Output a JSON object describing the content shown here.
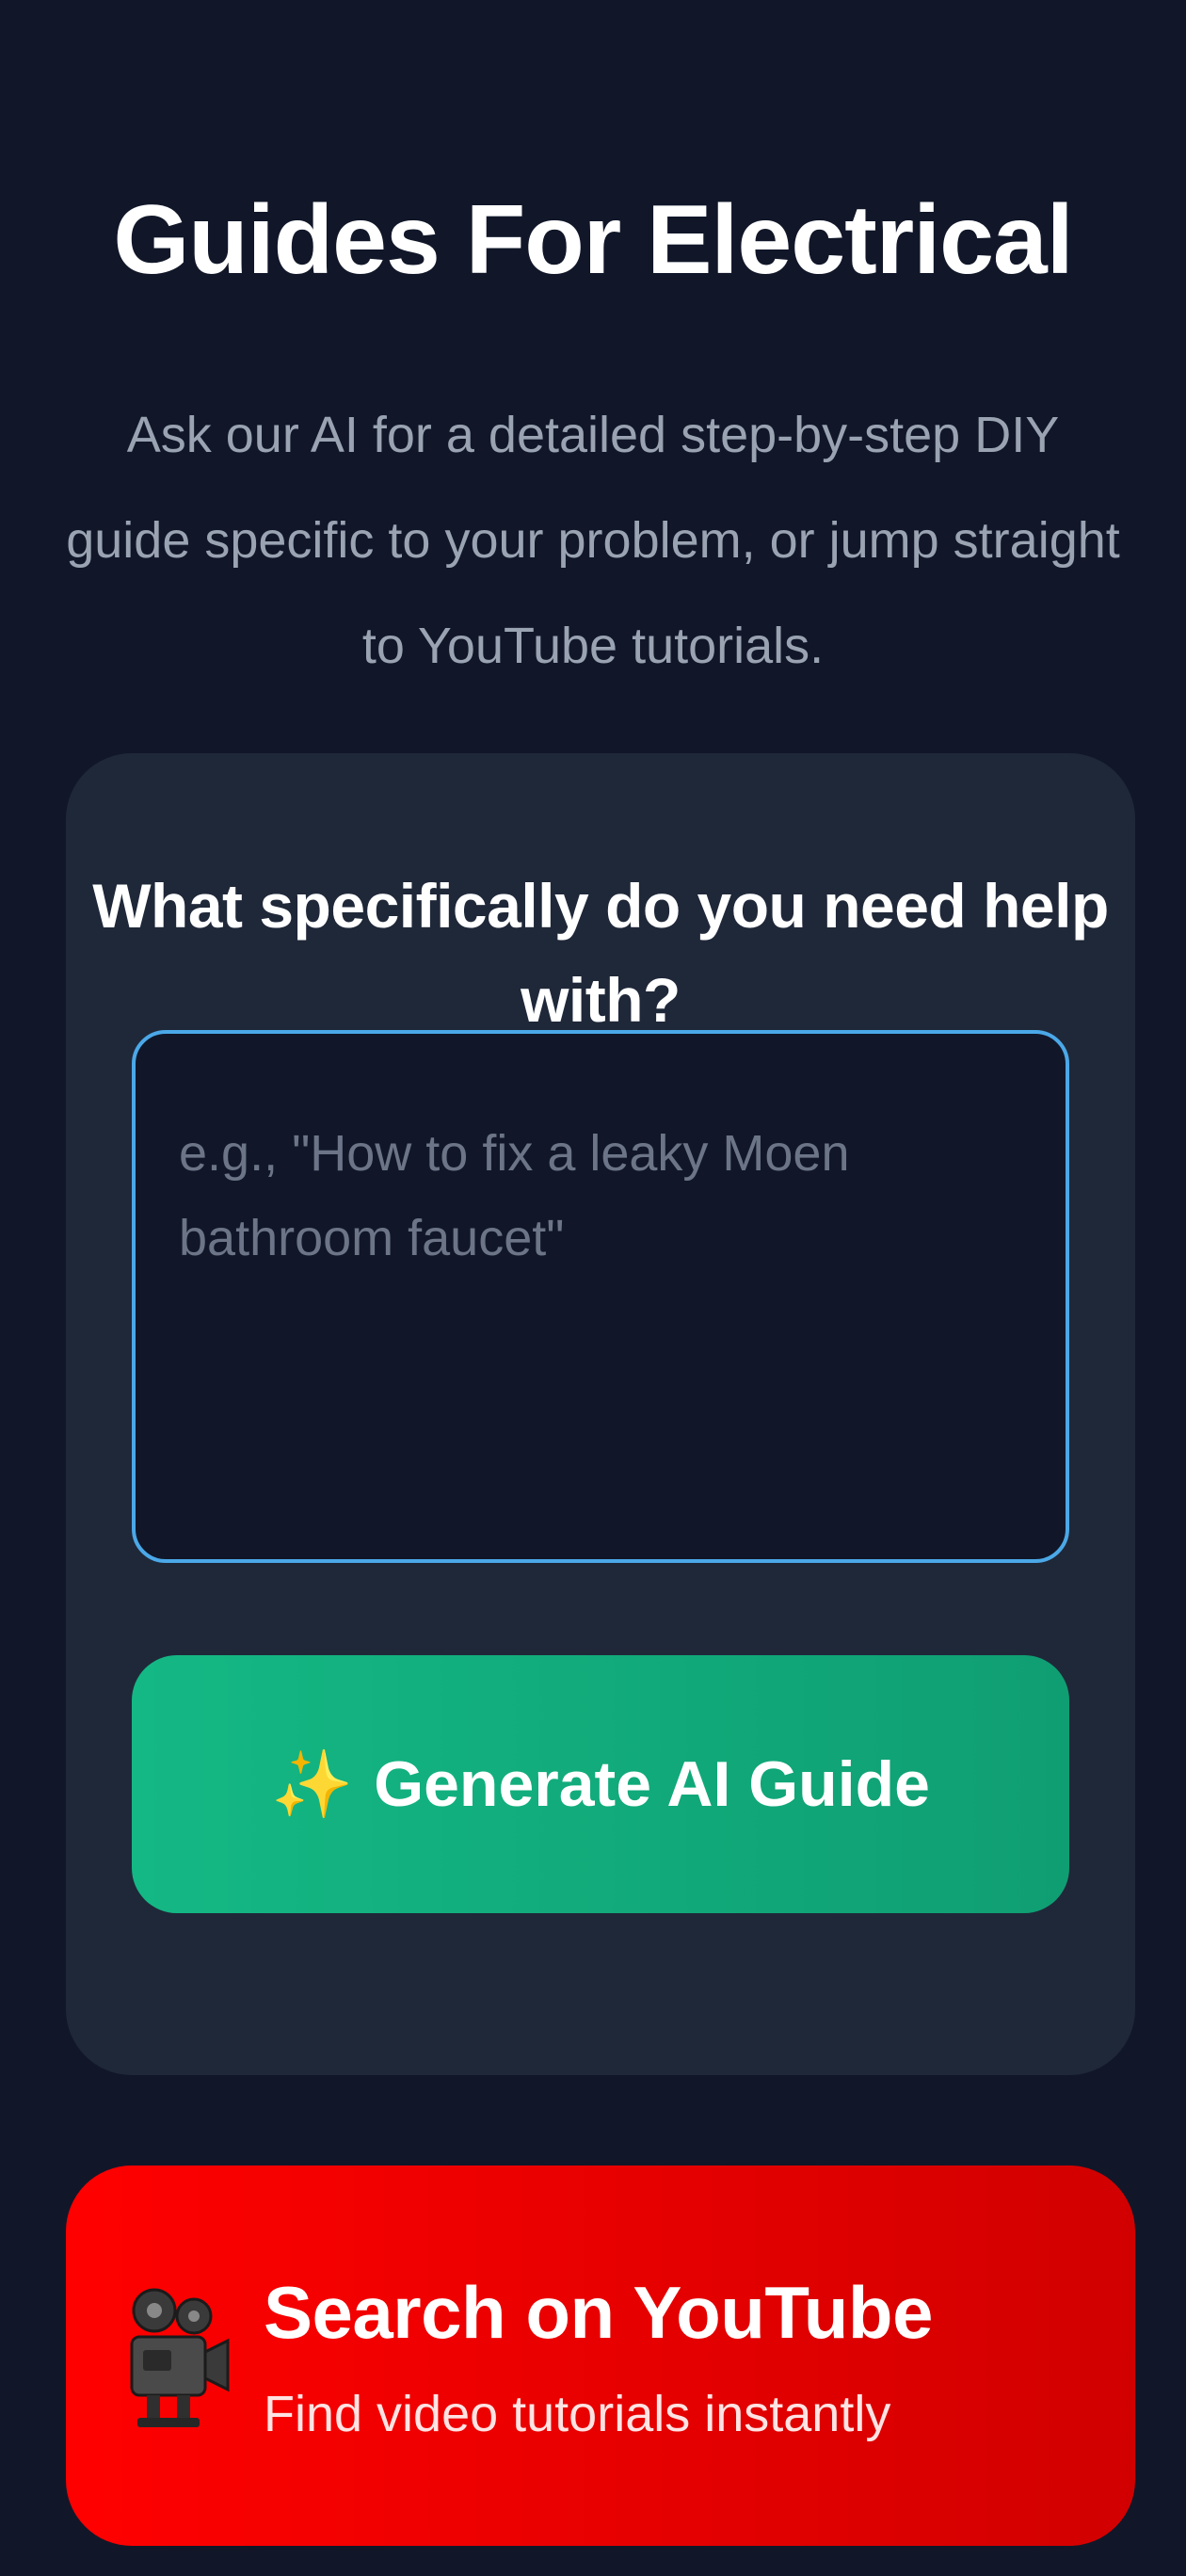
{
  "header": {
    "title": "Guides For Electrical",
    "subtitle": "Ask our AI for a detailed step-by-step DIY guide specific to your problem, or jump straight to YouTube tutorials."
  },
  "ai_card": {
    "heading": "What specifically do you need help with?",
    "input_placeholder": "e.g., \"How to fix a leaky Moen bathroom faucet\"",
    "input_value": "",
    "generate_icon": "sparkles-icon",
    "generate_label": "Generate AI Guide"
  },
  "youtube": {
    "icon": "movie-camera-icon",
    "title": "Search on YouTube",
    "subtitle": "Find video tutorials instantly"
  },
  "colors": {
    "background": "#111729",
    "card": "#1f2839",
    "input_border": "#4ba8e8",
    "generate_button": "#12a97a",
    "youtube_button": "#ff0000"
  }
}
